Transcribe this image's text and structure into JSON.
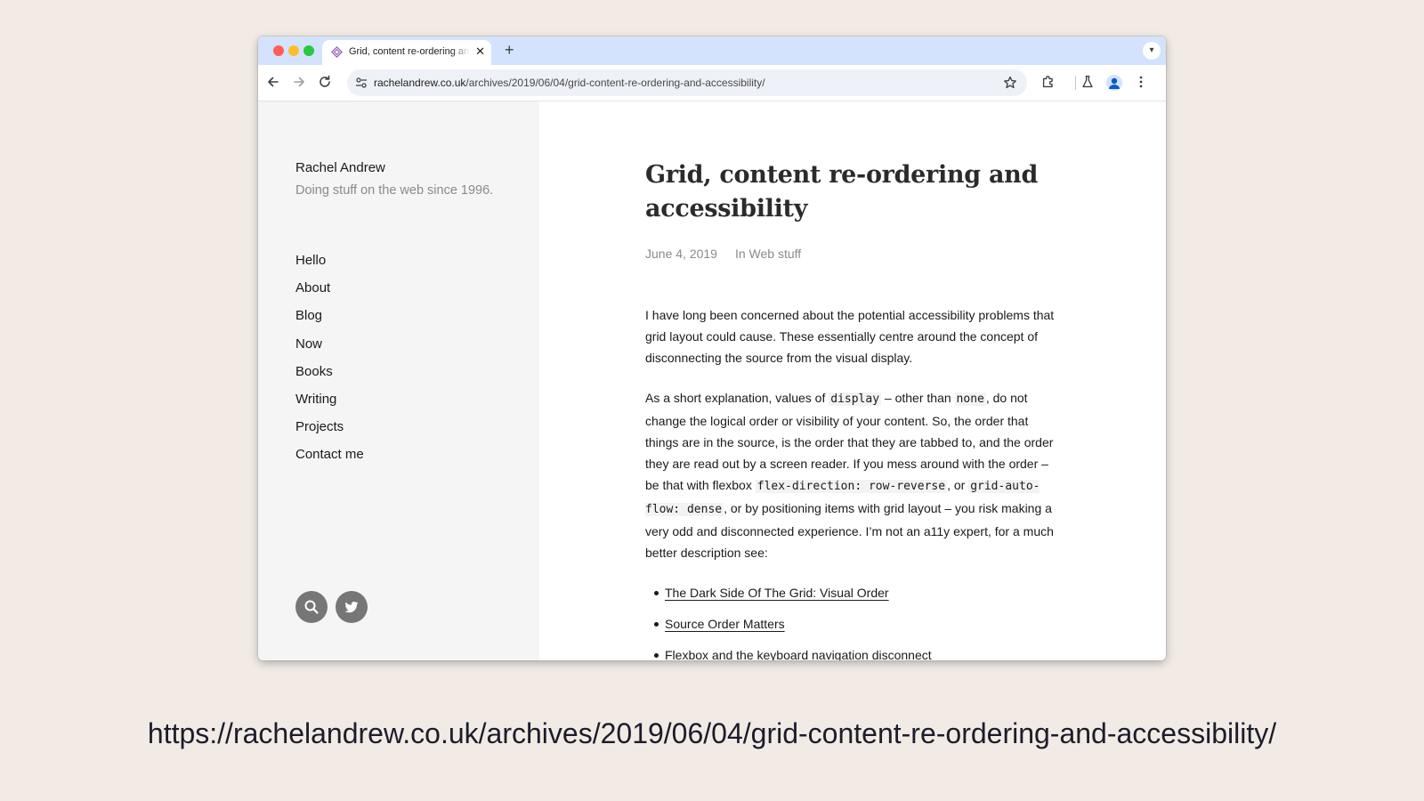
{
  "browser": {
    "tab_title": "Grid, content re-ordering and accessibility",
    "tab_close": "✕",
    "new_tab": "+",
    "tabs_dropdown": "▾",
    "url_host": "rachelandrew.co.uk",
    "url_path": "/archives/2019/06/04/grid-content-re-ordering-and-accessibility/"
  },
  "sidebar": {
    "site_name": "Rachel Andrew",
    "tagline": "Doing stuff on the web since 1996.",
    "nav": [
      "Hello",
      "About",
      "Blog",
      "Now",
      "Books",
      "Writing",
      "Projects",
      "Contact me"
    ],
    "icons": [
      "search-icon",
      "twitter-icon"
    ]
  },
  "post": {
    "title": "Grid, content re-ordering and accessibility",
    "date": "June 4, 2019",
    "category": "In Web stuff",
    "p1": "I have long been concerned about the potential accessibility problems that grid layout could cause. These essentially centre around the concept of disconnecting the source from the visual display.",
    "p2": {
      "t1": "As a short explanation, values of ",
      "c1": "display",
      "t2": " – other than ",
      "c2": "none",
      "t3": ", do not change the logical order or visibility of your content. So, the order that things are in the source, is the order that they are tabbed to, and the order they are read out by a screen reader. If you mess around with the order – be that with flexbox ",
      "c3": "flex-direction: row-reverse",
      "t4": ", or ",
      "c4": "grid-auto-flow: dense",
      "t5": ", or by positioning items with grid layout – you risk making a very odd and disconnected experience. I’m not an a11y expert, for a much better description see:"
    },
    "links": [
      "The Dark Side Of The Grid: Visual Order",
      "Source Order Matters",
      "Flexbox and the keyboard navigation disconnect"
    ]
  },
  "caption": "https://rachelandrew.co.uk/archives/2019/06/04/grid-content-re-ordering-and-accessibility/"
}
